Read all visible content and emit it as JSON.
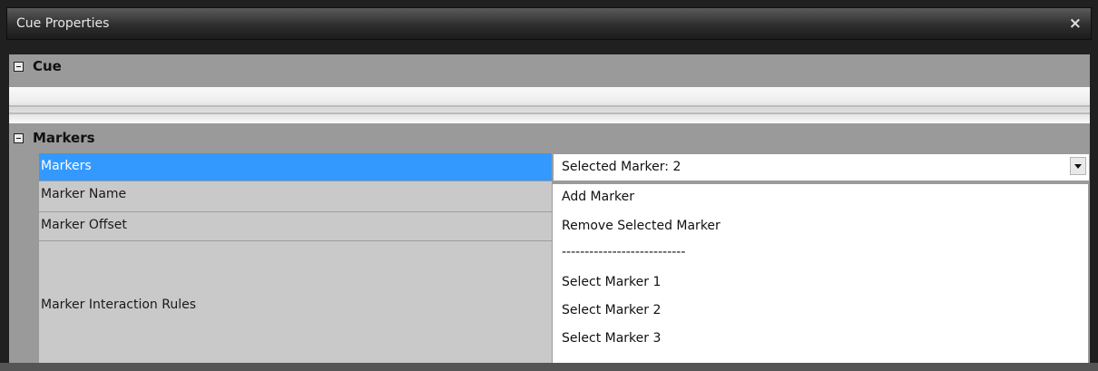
{
  "window": {
    "title": "Cue Properties",
    "close_glyph": "×"
  },
  "categories": {
    "cue": "Cue",
    "markers": "Markers"
  },
  "rows": [
    {
      "name": "Markers",
      "value": "Selected Marker: 2"
    },
    {
      "name": "Marker Name"
    },
    {
      "name": "Marker Offset"
    },
    {
      "name": "Marker Interaction Rules"
    }
  ],
  "dropdown_options": [
    "Add Marker",
    "Remove Selected Marker",
    "---------------------------",
    "Select Marker 1",
    "Select Marker 2",
    "Select Marker 3"
  ],
  "colors": {
    "selection": "#3399ff",
    "titlebar": "#2e2e2e",
    "grid_bg": "#9a9a9a"
  }
}
